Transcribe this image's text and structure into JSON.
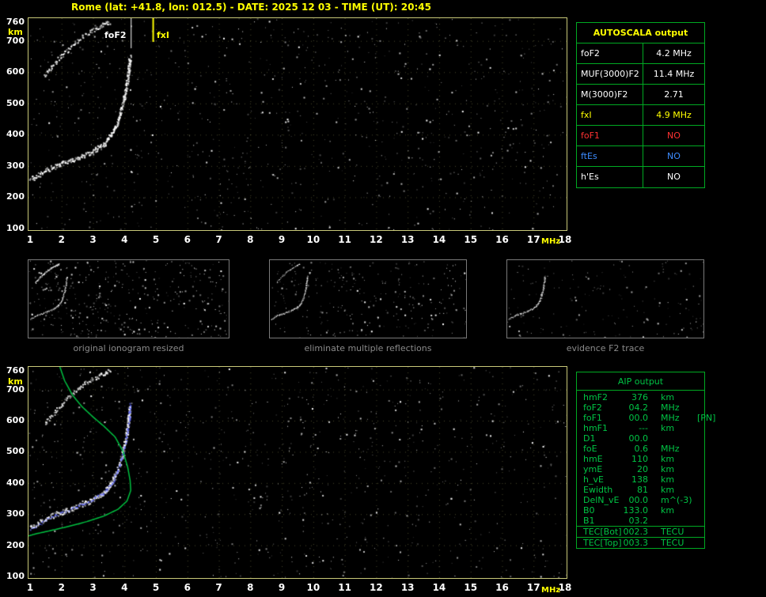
{
  "title": "Rome (lat: +41.8, lon: 012.5) - DATE: 2025 12 03 - TIME (UT): 20:45",
  "axes": {
    "x_unit": "MHz",
    "y_unit": "km",
    "x_ticks": [
      1,
      2,
      3,
      4,
      5,
      6,
      7,
      8,
      9,
      10,
      11,
      12,
      13,
      14,
      15,
      16,
      17,
      18
    ],
    "y_ticks": [
      760,
      700,
      600,
      500,
      400,
      300,
      200,
      100
    ],
    "x_range_mhz": [
      1,
      18
    ],
    "y_range_km": [
      100,
      780
    ]
  },
  "top_plot": {
    "foF2_label": "foF2",
    "fxI_label": "fxI",
    "foF2_mhz": 4.2,
    "fxI_mhz": 4.9
  },
  "autoscala": {
    "title": "AUTOSCALA output",
    "rows": [
      {
        "param": "foF2",
        "value": "4.2 MHz",
        "color": "white"
      },
      {
        "param": "MUF(3000)F2",
        "value": "11.4 MHz",
        "color": "white"
      },
      {
        "param": "M(3000)F2",
        "value": "2.71",
        "color": "white"
      },
      {
        "param": "fxI",
        "value": "4.9 MHz",
        "color": "yellow"
      },
      {
        "param": "foF1",
        "value": "NO",
        "color": "red"
      },
      {
        "param": "ftEs",
        "value": "NO",
        "color": "blue"
      },
      {
        "param": "h'Es",
        "value": "NO",
        "color": "white"
      }
    ]
  },
  "thumbnails": [
    {
      "caption": "original ionogram resized"
    },
    {
      "caption": "eliminate multiple reflections"
    },
    {
      "caption": "evidence F2 trace"
    }
  ],
  "aip": {
    "title": "AIP output",
    "rows": [
      {
        "name": "hmF2",
        "value": "376",
        "unit": "km"
      },
      {
        "name": "foF2",
        "value": "04.2",
        "unit": "MHz"
      },
      {
        "name": "foF1",
        "value": "00.0",
        "unit": "MHz",
        "note": "[PN]"
      },
      {
        "name": "hmF1",
        "value": "---",
        "unit": "km"
      },
      {
        "name": "D1",
        "value": "00.0",
        "unit": ""
      },
      {
        "name": "foE",
        "value": "0.6",
        "unit": "MHz"
      },
      {
        "name": "hmE",
        "value": "110",
        "unit": "km"
      },
      {
        "name": "ymE",
        "value": "20",
        "unit": "km"
      },
      {
        "name": "h_vE",
        "value": "138",
        "unit": "km"
      },
      {
        "name": "Ewidth",
        "value": "81",
        "unit": "km"
      },
      {
        "name": "DelN_vE",
        "value": "00.0",
        "unit": "m^(-3)"
      },
      {
        "name": "B0",
        "value": "133.0",
        "unit": "km"
      },
      {
        "name": "B1",
        "value": "03.2",
        "unit": ""
      },
      {
        "name": "TEC[Bot]",
        "value": "002.3",
        "unit": "TECU"
      },
      {
        "name": "TEC[Top]",
        "value": "003.3",
        "unit": "TECU"
      }
    ]
  },
  "ionogram": {
    "trace_main": [
      [
        1.0,
        258
      ],
      [
        1.5,
        288
      ],
      [
        2.0,
        308
      ],
      [
        2.5,
        326
      ],
      [
        3.0,
        348
      ],
      [
        3.35,
        372
      ],
      [
        3.6,
        405
      ],
      [
        3.8,
        450
      ],
      [
        3.95,
        505
      ],
      [
        4.05,
        555
      ],
      [
        4.12,
        605
      ],
      [
        4.16,
        648
      ]
    ],
    "trace_second": [
      [
        1.45,
        592
      ],
      [
        1.85,
        640
      ],
      [
        2.3,
        685
      ],
      [
        2.75,
        722
      ],
      [
        3.2,
        748
      ],
      [
        3.5,
        762
      ]
    ],
    "restored_trace": [
      [
        1.0,
        252
      ],
      [
        1.6,
        290
      ],
      [
        2.2,
        315
      ],
      [
        2.8,
        340
      ],
      [
        3.3,
        368
      ],
      [
        3.6,
        402
      ],
      [
        3.8,
        448
      ],
      [
        3.95,
        500
      ],
      [
        4.08,
        560
      ],
      [
        4.14,
        615
      ],
      [
        4.17,
        655
      ]
    ],
    "profile": [
      [
        1.93,
        778
      ],
      [
        2.1,
        728
      ],
      [
        2.35,
        682
      ],
      [
        2.65,
        645
      ],
      [
        3.0,
        612
      ],
      [
        3.35,
        582
      ],
      [
        3.7,
        548
      ],
      [
        3.95,
        502
      ],
      [
        4.1,
        452
      ],
      [
        4.18,
        408
      ],
      [
        4.2,
        376
      ],
      [
        4.08,
        342
      ],
      [
        3.8,
        316
      ],
      [
        3.35,
        294
      ],
      [
        2.8,
        276
      ],
      [
        2.2,
        260
      ],
      [
        1.6,
        246
      ],
      [
        1.15,
        236
      ],
      [
        0.95,
        230
      ]
    ],
    "profile_color": "#00c040",
    "restored_color": "#5a64ff",
    "trace_color": "#ffffff"
  }
}
